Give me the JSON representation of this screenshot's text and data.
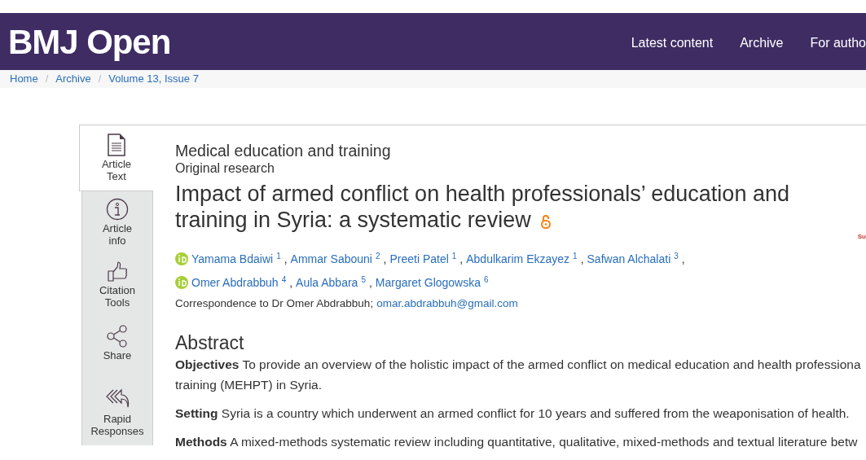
{
  "header": {
    "logo": "BMJ Open",
    "nav": [
      {
        "label": "Latest content"
      },
      {
        "label": "Archive"
      },
      {
        "label": "For autho"
      }
    ]
  },
  "breadcrumb": [
    {
      "label": "Home"
    },
    {
      "separator": "/",
      "label": "Archive"
    },
    {
      "separator": "/",
      "label": "Volume 13, Issue 7"
    }
  ],
  "sidebar": {
    "items": [
      {
        "label": "Article\nText",
        "kind": "document",
        "selected": true
      },
      {
        "label": "Article\ninfo",
        "kind": "info",
        "selected": false
      },
      {
        "label": "Citation\nTools",
        "kind": "thumb",
        "selected": false
      },
      {
        "label": "Share",
        "kind": "share",
        "selected": false
      },
      {
        "label": "Rapid\nResponses",
        "kind": "reply",
        "selected": false
      }
    ]
  },
  "article": {
    "section": "Medical education and training",
    "type": "Original research",
    "title": "Impact of armed conflict on health professionals’ education and training in Syria: a systematic review",
    "open_access": true,
    "side_label": "Su",
    "authors": [
      {
        "name": "Yamama Bdaiwi",
        "sup": "1",
        "orcid": true,
        "separator": ","
      },
      {
        "name": "Ammar Sabouni",
        "sup": "2",
        "orcid": false,
        "separator": ","
      },
      {
        "name": "Preeti Patel",
        "sup": "1",
        "orcid": false,
        "separator": ","
      },
      {
        "name": "Abdulkarim Ekzayez",
        "sup": "1",
        "orcid": false,
        "separator": ","
      },
      {
        "name": "Safwan Alchalati",
        "sup": "3",
        "orcid": false,
        "separator": ","
      },
      {
        "name": "Omer Abdrabbuh",
        "sup": "4",
        "orcid": true,
        "separator": ","
      },
      {
        "name": "Aula Abbara",
        "sup": "5",
        "orcid": false,
        "separator": ","
      },
      {
        "name": "Margaret Glogowska",
        "sup": "6",
        "orcid": false
      }
    ],
    "correspondence": {
      "text": "Correspondence to Dr Omer Abdrabbuh;",
      "email": "omar.abdrabbuh@gmail.com"
    },
    "abstract": {
      "heading": "Abstract",
      "paragraphs": [
        {
          "label": "Objectives",
          "lines": [
            "To provide an overview of the holistic impact of the armed conflict on medical education and health professiona",
            "training (MEHPT) in Syria."
          ]
        },
        {
          "label": "Setting",
          "lines": [
            "Syria is a country which underwent an armed conflict for 10 years and suffered from the weaponisation of health."
          ]
        },
        {
          "label": "Methods",
          "lines": [
            "A mixed-methods systematic review including quantitative, qualitative, mixed-methods and textual literature betw"
          ]
        }
      ]
    }
  }
}
